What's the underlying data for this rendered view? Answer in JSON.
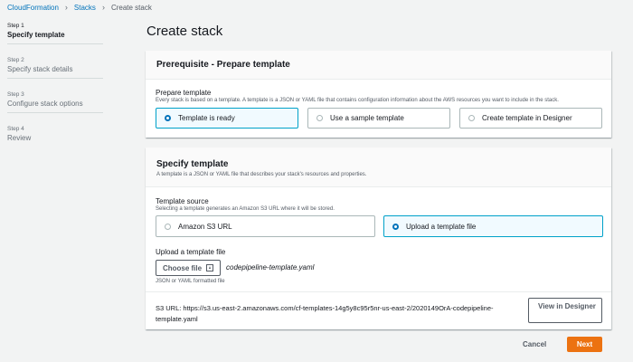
{
  "breadcrumb": {
    "items": [
      "CloudFormation",
      "Stacks",
      "Create stack"
    ]
  },
  "sidebar": {
    "steps": [
      {
        "num": "Step 1",
        "title": "Specify template"
      },
      {
        "num": "Step 2",
        "title": "Specify stack details"
      },
      {
        "num": "Step 3",
        "title": "Configure stack options"
      },
      {
        "num": "Step 4",
        "title": "Review"
      }
    ]
  },
  "page_title": "Create stack",
  "prerequisite": {
    "title": "Prerequisite - Prepare template",
    "field_label": "Prepare template",
    "field_desc": "Every stack is based on a template. A template is a JSON or YAML file that contains configuration information about the AWS resources you want to include in the stack.",
    "options": [
      "Template is ready",
      "Use a sample template",
      "Create template in Designer"
    ],
    "selected": "Template is ready"
  },
  "specify": {
    "title": "Specify template",
    "desc": "A template is a JSON or YAML file that describes your stack's resources and properties.",
    "source_label": "Template source",
    "source_desc": "Selecting a template generates an Amazon S3 URL where it will be stored.",
    "source_options": [
      "Amazon S3 URL",
      "Upload a template file"
    ],
    "source_selected": "Upload a template file",
    "upload_label": "Upload a template file",
    "choose_file": "Choose file",
    "file_name": "codepipeline-template.yaml",
    "file_hint": "JSON or YAML formatted file",
    "s3_url_text": "S3 URL:  https://s3.us-east-2.amazonaws.com/cf-templates-14g5y8c95r5nr-us-east-2/2020149OrA-codepipeline-template.yaml",
    "view_designer": "View in Designer"
  },
  "footer": {
    "cancel": "Cancel",
    "next": "Next"
  },
  "colors": {
    "accent": "#0073bb",
    "primary_button": "#ec7211",
    "selected_tile_bg": "#f1faff"
  }
}
